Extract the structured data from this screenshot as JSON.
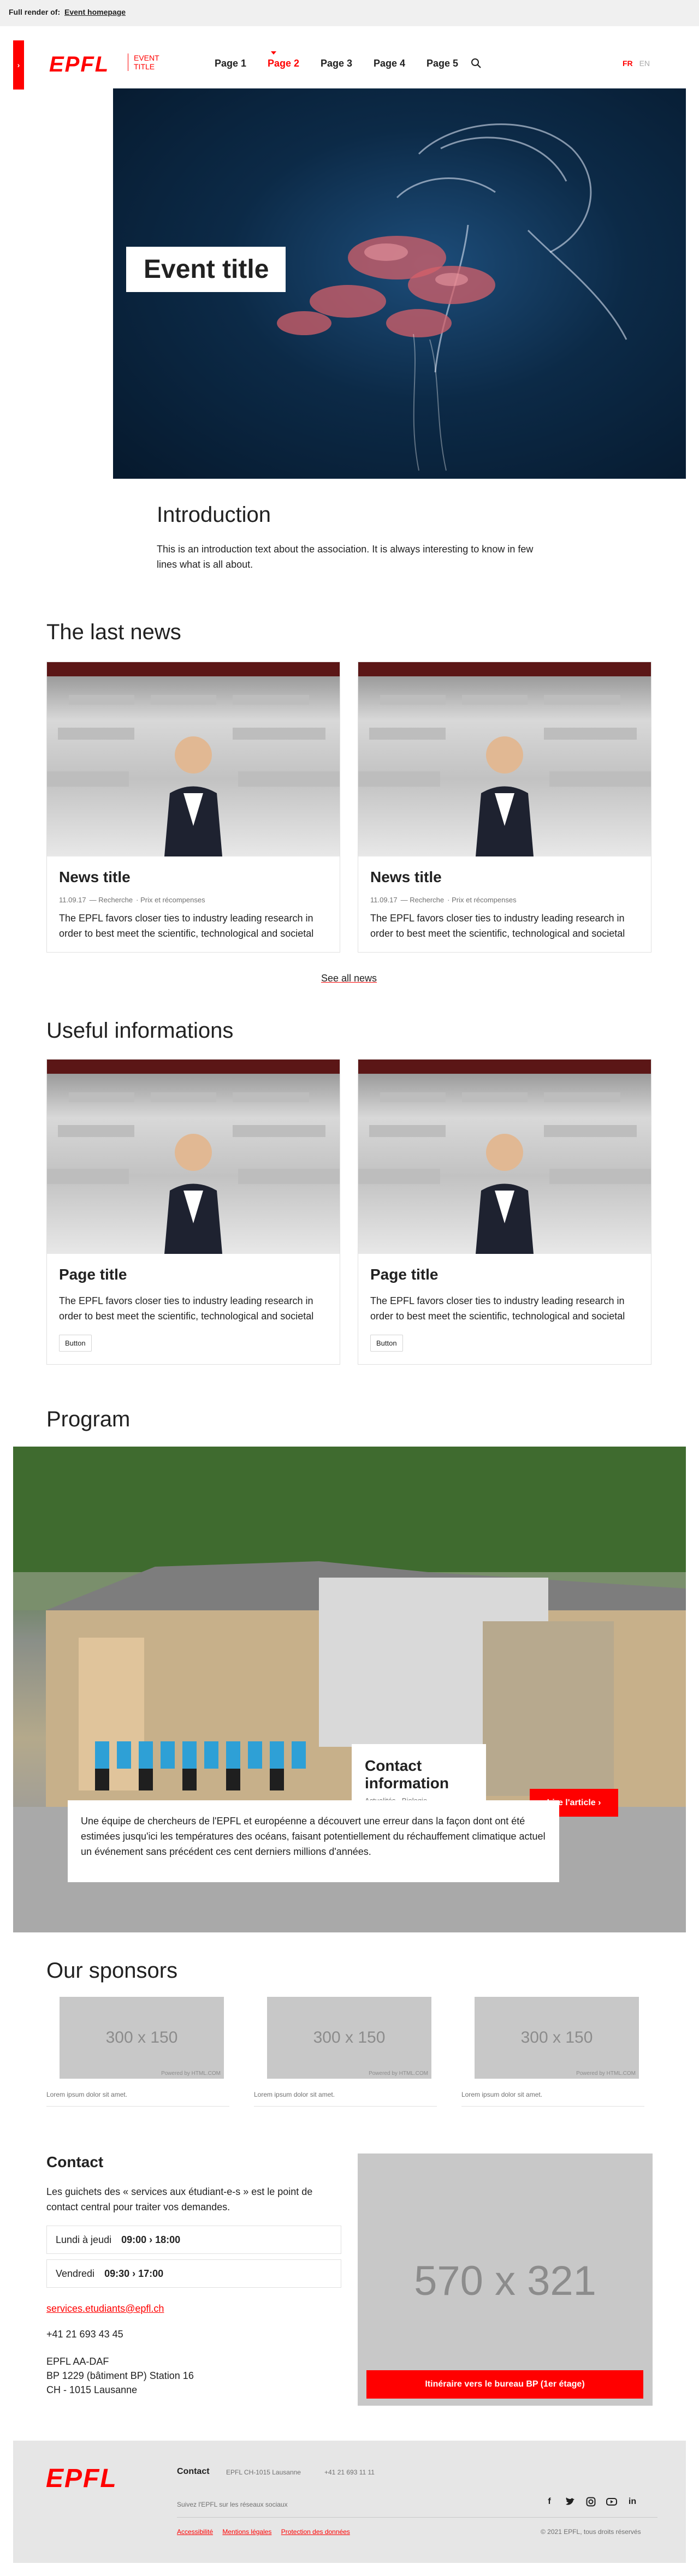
{
  "render_bar": {
    "prefix": "Full render of:",
    "link": "Event homepage"
  },
  "header": {
    "drawer": "›",
    "logo": "EPFL",
    "site_title_1": "EVENT",
    "site_title_2": "TITLE",
    "nav": [
      "Page 1",
      "Page 2",
      "Page 3",
      "Page 4",
      "Page 5"
    ],
    "active_nav_index": 1,
    "lang_fr": "FR",
    "lang_en": "EN"
  },
  "hero": {
    "title": "Event title"
  },
  "intro": {
    "title": "Introduction",
    "text": "This is an introduction text about the association. It is always interesting to know in few lines what is all about."
  },
  "news": {
    "title": "The last news",
    "cards": [
      {
        "title": "News title",
        "date": "11.09.17",
        "tag1": "Recherche",
        "tag2": "Prix et récompenses",
        "text": "The EPFL favors closer ties to industry leading research in order to best meet the scientific, technological and societal"
      },
      {
        "title": "News title",
        "date": "11.09.17",
        "tag1": "Recherche",
        "tag2": "Prix et récompenses",
        "text": "The EPFL favors closer ties to industry leading research in order to best meet the scientific, technological and societal"
      }
    ],
    "see_all": "See all news"
  },
  "useful": {
    "title": "Useful informations",
    "cards": [
      {
        "title": "Page title",
        "text": "The EPFL favors closer ties to industry leading research in order to best meet the scientific, technological and societal",
        "button": "Button"
      },
      {
        "title": "Page title",
        "text": "The EPFL favors closer ties to industry leading research in order to best meet the scientific, technological and societal",
        "button": "Button"
      }
    ]
  },
  "program": {
    "title": "Program",
    "card_title": "Contact information",
    "tags": "Actualités · Biologie",
    "button": "Lire l'article ›",
    "text": "Une équipe de chercheurs de l'EPFL et européenne a découvert une erreur dans la façon dont ont été estimées jusqu'ici les températures des océans, faisant potentiellement du réchauffement climatique actuel un événement sans précédent ces cent derniers millions d'années."
  },
  "sponsors": {
    "title": "Our sponsors",
    "items": [
      {
        "dim": "300 x 150",
        "credit": "Powered by HTML.COM",
        "caption": "Lorem ipsum dolor sit amet."
      },
      {
        "dim": "300 x 150",
        "credit": "Powered by HTML.COM",
        "caption": "Lorem ipsum dolor sit amet."
      },
      {
        "dim": "300 x 150",
        "credit": "Powered by HTML.COM",
        "caption": "Lorem ipsum dolor sit amet."
      }
    ]
  },
  "contact": {
    "title": "Contact",
    "lead": "Les guichets des « services aux étudiant-e-s » est le point de contact central pour traiter vos demandes.",
    "hours": [
      {
        "day": "Lundi à jeudi",
        "time": "09:00 › 18:00"
      },
      {
        "day": "Vendredi",
        "time": "09:30 › 17:00"
      }
    ],
    "email": "services.etudiants@epfl.ch",
    "phone": "+41 21 693 43 45",
    "address": [
      "EPFL AA-DAF",
      "BP 1229 (bâtiment BP) Station 16",
      "CH - 1015 Lausanne"
    ],
    "map_dim": "570 x 321",
    "map_button": "Itinéraire vers le bureau BP (1er étage)"
  },
  "footer": {
    "logo": "EPFL",
    "contact": "Contact",
    "address": "EPFL CH-1015 Lausanne",
    "phone": "+41 21 693 11 11",
    "follow": "Suivez l'EPFL sur les réseaux sociaux",
    "links": [
      "Accessibilité",
      "Mentions légales",
      "Protection des données"
    ],
    "copyright": "© 2021 EPFL, tous droits réservés",
    "social": [
      "f",
      "t",
      "ig",
      "yt",
      "in"
    ]
  }
}
